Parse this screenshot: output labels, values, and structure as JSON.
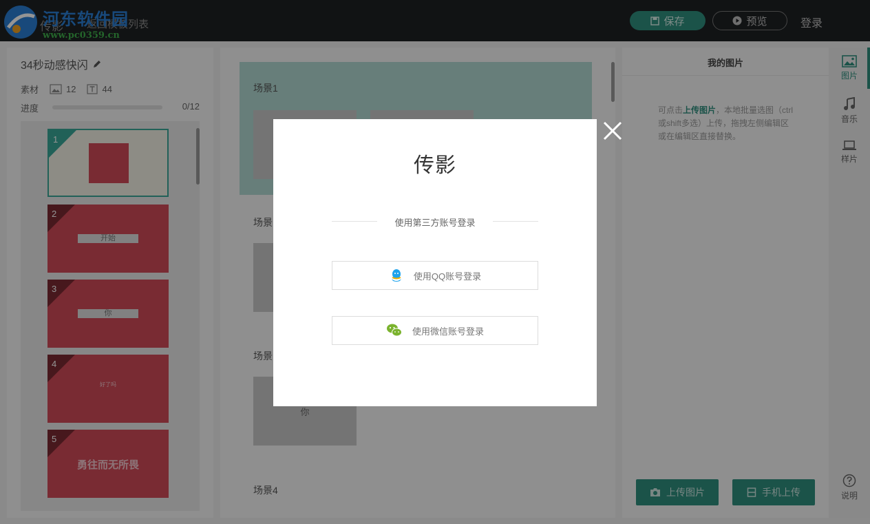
{
  "watermark": {
    "title": "河东软件园",
    "url": "www.pc0359.cn"
  },
  "header": {
    "brand": "传影",
    "back_link": "返回模板列表",
    "save_label": "保存",
    "preview_label": "预览",
    "login_label": "登录"
  },
  "project": {
    "title": "34秒动感快闪",
    "materials_label": "素材",
    "image_count": "12",
    "text_count": "44",
    "progress_label": "进度",
    "progress_value": 0,
    "progress_text": "0/12"
  },
  "thumbnails": [
    {
      "num": "1",
      "text": ""
    },
    {
      "num": "2",
      "text": "开始"
    },
    {
      "num": "3",
      "text": "你"
    },
    {
      "num": "4",
      "text": "好了吗"
    },
    {
      "num": "5",
      "text": "勇往而无所畏"
    }
  ],
  "scenes": [
    {
      "label": "场景1"
    },
    {
      "label": "场景"
    },
    {
      "label": "场景"
    },
    {
      "label": "场景4"
    }
  ],
  "scene3_slot_text": "你",
  "right_panel": {
    "title": "我的图片",
    "tip_prefix": "可点击",
    "tip_highlight": "上传图片",
    "tip_rest": "，本地批量选图（ctrl或shift多选）上传，拖拽左侧编辑区或在编辑区直接替换。",
    "upload_label": "上传图片",
    "mobile_upload_label": "手机上传"
  },
  "side_nav": {
    "images": "图片",
    "music": "音乐",
    "templates": "样片",
    "help": "说明"
  },
  "modal": {
    "logo": "传影",
    "divider_text": "使用第三方账号登录",
    "qq_label": "使用QQ账号登录",
    "wechat_label": "使用微信账号登录"
  },
  "colors": {
    "accent": "#2f8f7f",
    "thumb_red": "#d04a58",
    "qq_blue": "#1fa3ec",
    "wechat_green": "#7bb32e"
  }
}
